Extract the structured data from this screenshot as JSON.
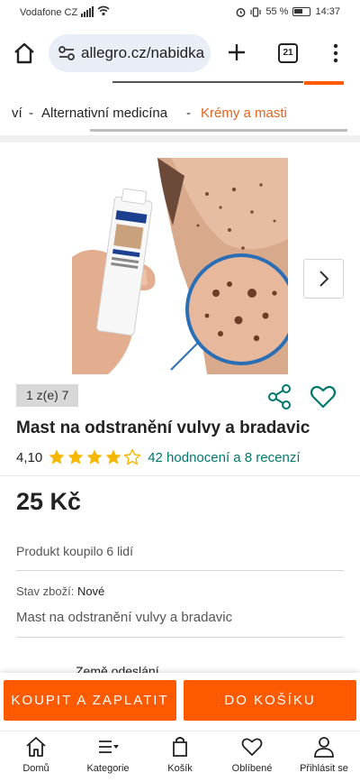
{
  "status_bar": {
    "carrier": "Vodafone CZ",
    "battery": "55 %",
    "time": "14:37"
  },
  "browser": {
    "url": "allegro.cz/nabidka",
    "tab_count": "21",
    "icons": [
      "home-icon",
      "site-settings-icon",
      "plus-icon",
      "tabs-icon",
      "more-icon"
    ]
  },
  "breadcrumb": {
    "items": [
      "ví",
      "Alternativní medicína",
      "Krémy a masti"
    ],
    "separator": "-"
  },
  "gallery": {
    "counter": "1 z(e) 7",
    "product_label_lines": [
      "MOLE REMOVER",
      "OINTMENT"
    ]
  },
  "product": {
    "title": "Mast na odstranění vulvy a bradavic",
    "rating_value": "4,10",
    "rating_stars": 4.1,
    "rating_max": 5,
    "reviews_link": "42 hodnocení a 8 recenzí",
    "price": "25 Kč",
    "bought_text": "Produkt koupilo 6 lidí",
    "condition_label": "Stav zboží:",
    "condition_value": "Nové",
    "description": "Mast na odstranění vulvy a bradavic",
    "partial_label": "Země odeslání"
  },
  "actions": {
    "buy_label": "KOUPIT A ZAPLATIT",
    "cart_label": "DO KOŠÍKU"
  },
  "bottom_nav": {
    "items": [
      {
        "label": "Domů",
        "icon": "home-icon"
      },
      {
        "label": "Kategorie",
        "icon": "categories-icon"
      },
      {
        "label": "Košík",
        "icon": "cart-icon"
      },
      {
        "label": "Oblíbené",
        "icon": "heart-icon"
      },
      {
        "label": "Přihlásit se",
        "icon": "user-icon"
      }
    ]
  },
  "colors": {
    "accent": "#ff5a00",
    "link_teal": "#00796b",
    "star": "#f5b700",
    "breadcrumb_current": "#e0651f"
  }
}
